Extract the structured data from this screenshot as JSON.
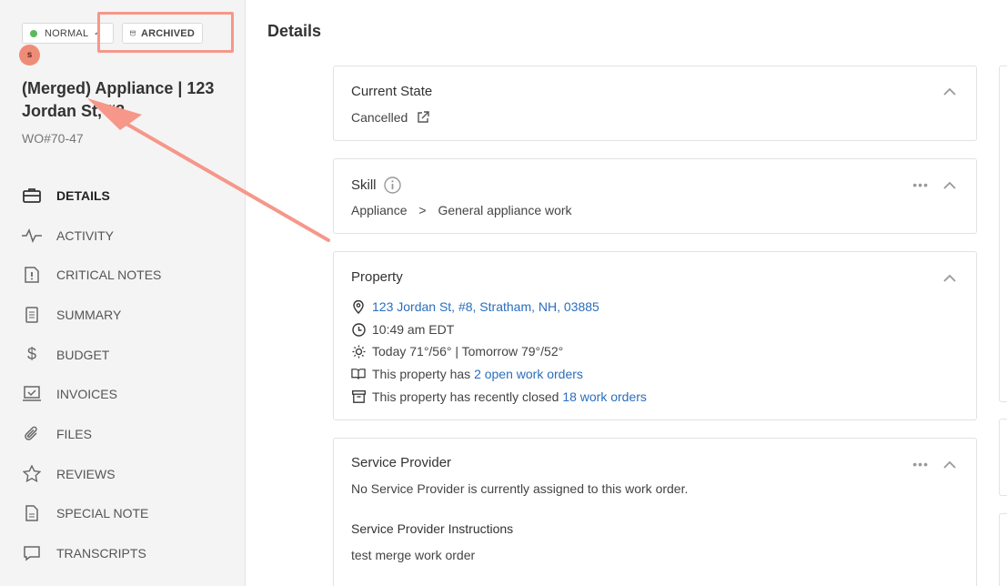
{
  "sidebar": {
    "priority_chip": {
      "label": "NORMAL",
      "dot_color": "#5cb85c"
    },
    "status_chip": {
      "label": "ARCHIVED"
    },
    "avatar_letter": "s",
    "title": "(Merged) Appliance | 123 Jordan St, #8",
    "wo_number": "WO#70-47",
    "nav": [
      {
        "label": "DETAILS",
        "icon": "briefcase-icon",
        "active": true
      },
      {
        "label": "ACTIVITY",
        "icon": "pulse-icon"
      },
      {
        "label": "CRITICAL NOTES",
        "icon": "critical-note-icon"
      },
      {
        "label": "SUMMARY",
        "icon": "document-icon"
      },
      {
        "label": "BUDGET",
        "icon": "dollar-icon"
      },
      {
        "label": "INVOICES",
        "icon": "invoice-icon"
      },
      {
        "label": "FILES",
        "icon": "paperclip-icon"
      },
      {
        "label": "REVIEWS",
        "icon": "star-icon"
      },
      {
        "label": "SPECIAL NOTE",
        "icon": "note-icon"
      },
      {
        "label": "TRANSCRIPTS",
        "icon": "chat-icon"
      }
    ]
  },
  "main": {
    "title": "Details",
    "current_state": {
      "title": "Current State",
      "value": "Cancelled"
    },
    "skill": {
      "title": "Skill",
      "category": "Appliance",
      "separator": ">",
      "subcategory": "General appliance work"
    },
    "property": {
      "title": "Property",
      "address": "123 Jordan St, #8, Stratham, NH, 03885",
      "time": "10:49 am EDT",
      "weather": "Today 71°/56° | Tomorrow 79°/52°",
      "open_prefix": "This property has ",
      "open_link": "2 open work orders",
      "closed_prefix": "This property has recently closed ",
      "closed_link": "18 work orders"
    },
    "service_provider": {
      "title": "Service Provider",
      "text": "No Service Provider is currently assigned to this work order.",
      "instructions_title": "Service Provider Instructions",
      "instructions": "test merge work order"
    }
  },
  "colors": {
    "annotation": "#f6978a",
    "link": "#2a6ebb"
  }
}
